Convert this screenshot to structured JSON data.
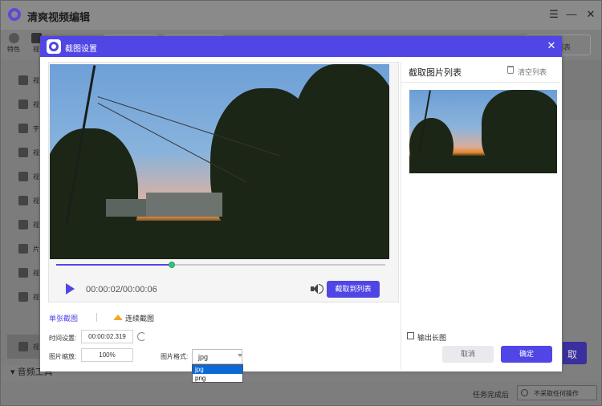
{
  "app": {
    "title": "清爽视频编辑",
    "tabs": [
      {
        "label": "特色"
      },
      {
        "label": "视"
      }
    ],
    "sidebar_items": [
      {
        "label": "视"
      },
      {
        "label": "视"
      },
      {
        "label": "字"
      },
      {
        "label": "视"
      },
      {
        "label": "视"
      },
      {
        "label": "视"
      },
      {
        "label": "视"
      },
      {
        "label": "片"
      },
      {
        "label": "视"
      },
      {
        "label": "视"
      },
      {
        "label": "视"
      }
    ],
    "sidebar_group": "音频工具",
    "top_right_button": "列表",
    "right_action_button": "取",
    "status": {
      "after_task_label": "任务完成后",
      "after_task_value": "不采取任何操作"
    }
  },
  "dialog": {
    "title": "截图设置",
    "time_display": "00:00:02/00:00:06",
    "capture_button": "截取到列表",
    "progress": 0.35,
    "mode_single": "单张截图",
    "mode_continuous": "连续截图",
    "time_setting_label": "时间设置:",
    "time_setting_value": "00:00:02.319",
    "scale_label": "图片缩放:",
    "scale_value": "100%",
    "format_label": "图片格式:",
    "format_value": "jpg",
    "format_options": [
      "jpg",
      "png"
    ],
    "list_title": "截取图片列表",
    "clear_list": "清空列表",
    "output_long": "输出长图",
    "cancel": "取消",
    "confirm": "确定"
  },
  "colors": {
    "accent": "#5046e5",
    "progress_knob": "#3bbf7a",
    "crown": "#f3a724"
  }
}
